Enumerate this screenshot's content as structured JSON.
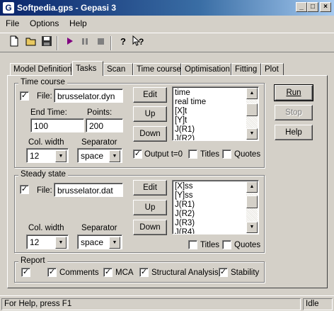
{
  "window": {
    "title": "Softpedia.gps  -  Gepasi 3",
    "app_icon": "gepasi-g-icon"
  },
  "menu": [
    {
      "label": "File"
    },
    {
      "label": "Options"
    },
    {
      "label": "Help"
    }
  ],
  "toolbar": {
    "buttons": [
      {
        "icon": "new-file-icon"
      },
      {
        "icon": "open-folder-icon"
      },
      {
        "icon": "save-disk-icon"
      },
      {
        "icon": "run-play-icon"
      },
      {
        "icon": "pause-icon"
      },
      {
        "icon": "stop-icon"
      },
      {
        "icon": "help-icon"
      },
      {
        "icon": "context-help-icon"
      }
    ]
  },
  "tabs": [
    {
      "label": "Model Definition"
    },
    {
      "label": "Tasks"
    },
    {
      "label": "Scan"
    },
    {
      "label": "Time course"
    },
    {
      "label": "Optimisation"
    },
    {
      "label": "Fitting"
    },
    {
      "label": "Plot"
    }
  ],
  "active_tab": "Tasks",
  "time_course": {
    "group_title": "Time course",
    "file_label": "File:",
    "file_value": "brusselator.dyn",
    "file_checked": true,
    "end_time_label": "End Time:",
    "end_time_value": "100",
    "points_label": "Points:",
    "points_value": "200",
    "col_width_label": "Col. width",
    "col_width_value": "12",
    "separator_label": "Separator",
    "separator_value": "space",
    "edit_label": "Edit",
    "up_label": "Up",
    "down_label": "Down",
    "list_items": [
      "time",
      "real time",
      "[X]t",
      "[Y]t",
      "J(R1)",
      "J(R2)"
    ],
    "output_t0_label": "Output t=0",
    "output_t0_checked": true,
    "titles_label": "Titles",
    "titles_checked": false,
    "quotes_label": "Quotes",
    "quotes_checked": false
  },
  "steady_state": {
    "group_title": "Steady state",
    "file_label": "File:",
    "file_value": "brusselator.dat",
    "file_checked": true,
    "col_width_label": "Col. width",
    "col_width_value": "12",
    "separator_label": "Separator",
    "separator_value": "space",
    "edit_label": "Edit",
    "up_label": "Up",
    "down_label": "Down",
    "list_items": [
      "[X]ss",
      "[Y]ss",
      "J(R1)",
      "J(R2)",
      "J(R3)",
      "J(R4)"
    ],
    "titles_label": "Titles",
    "titles_checked": false,
    "quotes_label": "Quotes",
    "quotes_checked": false
  },
  "report": {
    "group_title": "Report",
    "report_checked": true,
    "comments_label": "Comments",
    "comments_checked": true,
    "mca_label": "MCA",
    "mca_checked": true,
    "structural_label": "Structural Analysis",
    "structural_checked": true,
    "stability_label": "Stability",
    "stability_checked": true
  },
  "side_buttons": {
    "run": "Run",
    "stop": "Stop",
    "help": "Help"
  },
  "status": {
    "message": "For Help, press F1",
    "state": "Idle"
  }
}
